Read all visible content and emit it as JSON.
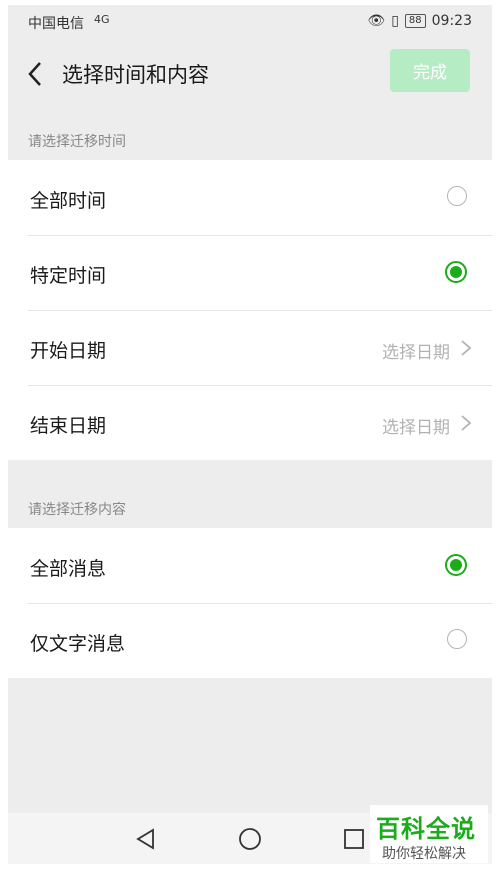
{
  "status_bar": {
    "carrier": "中国电信",
    "network": "4G",
    "battery": "88",
    "time": "09:23"
  },
  "header": {
    "back_icon": "back-chevron",
    "title": "选择时间和内容",
    "done_label": "完成",
    "done_color": "#b6ecc4"
  },
  "time_section": {
    "label": "请选择迁移时间",
    "options": [
      {
        "label": "全部时间",
        "selected": false
      },
      {
        "label": "特定时间",
        "selected": true
      }
    ],
    "start_date": {
      "label": "开始日期",
      "value": "选择日期"
    },
    "end_date": {
      "label": "结束日期",
      "value": "选择日期"
    }
  },
  "content_section": {
    "label": "请选择迁移内容",
    "options": [
      {
        "label": "全部消息",
        "selected": true
      },
      {
        "label": "仅文字消息",
        "selected": false
      }
    ]
  },
  "accent_color": "#1aad19",
  "watermark": {
    "title": "百科全说",
    "subtitle": "助你轻松解决"
  }
}
